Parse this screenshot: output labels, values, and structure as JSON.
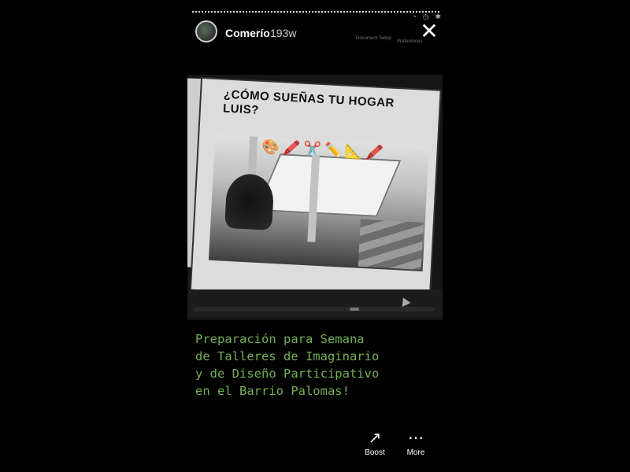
{
  "header": {
    "username": "Comerío",
    "age": "193w",
    "close_icon": "close-icon"
  },
  "slide": {
    "title": "¿CÓMO SUEÑAS TU HOGAR LUIS?",
    "emoji": [
      "🎨",
      "🖍️",
      "✂️",
      "✏️",
      "📐",
      "🖍️"
    ]
  },
  "caption": "Preparación para Semana\nde Talleres de Imaginario\ny de Diseño Participativo\nen el Barrio Palomas!",
  "actions": {
    "boost": "Boost",
    "more": "More"
  },
  "background_ui": {
    "doc_setup": "Document Setup",
    "preferences": "Preferences"
  },
  "colors": {
    "caption": "#73b056",
    "background": "#000000"
  }
}
